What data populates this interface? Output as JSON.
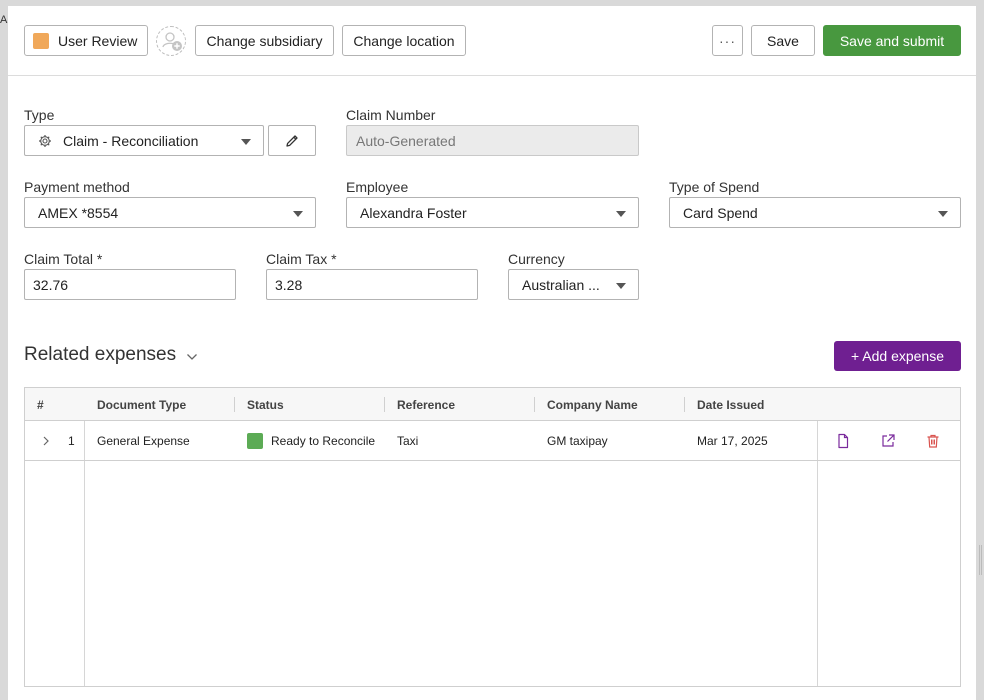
{
  "edge_letter": "A",
  "toolbar": {
    "status_label": "User Review",
    "status_color": "#f0a85a",
    "change_subsidiary_label": "Change subsidiary",
    "change_location_label": "Change location",
    "more_label": "···",
    "save_label": "Save",
    "save_submit_label": "Save and submit"
  },
  "form": {
    "type_label": "Type",
    "type_value": "Claim - Reconciliation",
    "claim_number_label": "Claim Number",
    "claim_number_value": "Auto-Generated",
    "payment_method_label": "Payment method",
    "payment_method_value": "AMEX *8554",
    "employee_label": "Employee",
    "employee_value": "Alexandra Foster",
    "type_of_spend_label": "Type of Spend",
    "type_of_spend_value": "Card Spend",
    "claim_total_label": "Claim Total *",
    "claim_total_value": "32.76",
    "claim_tax_label": "Claim Tax *",
    "claim_tax_value": "3.28",
    "currency_label": "Currency",
    "currency_value": "Australian ..."
  },
  "related": {
    "title": "Related expenses",
    "add_label": "+ Add expense",
    "columns": [
      "#",
      "Document Type",
      "Status",
      "Reference",
      "Company Name",
      "Date Issued"
    ],
    "rows": [
      {
        "index": "1",
        "document_type": "General Expense",
        "status": "Ready to Reconcile",
        "reference": "Taxi",
        "company_name": "GM taxipay",
        "date_issued": "Mar 17, 2025"
      }
    ]
  },
  "colors": {
    "accent_green": "#48983f",
    "accent_purple": "#6f1f91",
    "status_green": "#5cab55",
    "delete_red": "#d9534f"
  },
  "icons": [
    "gear-icon",
    "pencil-icon",
    "add-user-icon",
    "chevron-down-icon",
    "chevron-right-icon",
    "document-icon",
    "external-link-icon",
    "trash-icon"
  ]
}
